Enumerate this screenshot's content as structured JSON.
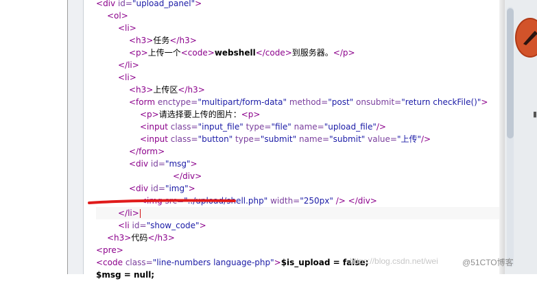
{
  "code_lines": [
    {
      "indent": 0,
      "parts": [
        {
          "t": "<",
          "k": "tag"
        },
        {
          "t": "div",
          "k": "tag"
        },
        {
          "t": " id=",
          "k": "attr"
        },
        {
          "t": "\"upload_panel\"",
          "k": "val"
        },
        {
          "t": ">",
          "k": "tag"
        }
      ]
    },
    {
      "indent": 1,
      "parts": [
        {
          "t": "<ol>",
          "k": "tag"
        }
      ]
    },
    {
      "indent": 2,
      "parts": [
        {
          "t": "<li>",
          "k": "tag"
        }
      ]
    },
    {
      "indent": 3,
      "parts": [
        {
          "t": "<h3>",
          "k": "tag"
        },
        {
          "t": "任务",
          "k": "text"
        },
        {
          "t": "</h3>",
          "k": "tag"
        }
      ]
    },
    {
      "indent": 3,
      "parts": [
        {
          "t": "<p>",
          "k": "tag"
        },
        {
          "t": "上传一个",
          "k": "text"
        },
        {
          "t": "<code>",
          "k": "tag"
        },
        {
          "t": "webshell",
          "k": "bold"
        },
        {
          "t": "</code>",
          "k": "tag"
        },
        {
          "t": "到服务器。",
          "k": "text"
        },
        {
          "t": "</p>",
          "k": "tag"
        }
      ]
    },
    {
      "indent": 2,
      "parts": [
        {
          "t": "</li>",
          "k": "tag"
        }
      ]
    },
    {
      "indent": 2,
      "parts": [
        {
          "t": "<li>",
          "k": "tag"
        }
      ]
    },
    {
      "indent": 3,
      "parts": [
        {
          "t": "<h3>",
          "k": "tag"
        },
        {
          "t": "上传区",
          "k": "text"
        },
        {
          "t": "</h3>",
          "k": "tag"
        }
      ]
    },
    {
      "indent": 3,
      "parts": [
        {
          "t": "<form",
          "k": "tag"
        },
        {
          "t": " enctype=",
          "k": "attr"
        },
        {
          "t": "\"multipart/form-data\"",
          "k": "val"
        },
        {
          "t": " method=",
          "k": "attr"
        },
        {
          "t": "\"post\"",
          "k": "val"
        },
        {
          "t": " onsubmit=",
          "k": "attr"
        },
        {
          "t": "\"return checkFile()\"",
          "k": "val"
        },
        {
          "t": ">",
          "k": "tag"
        }
      ]
    },
    {
      "indent": 4,
      "parts": [
        {
          "t": "<p>",
          "k": "tag"
        },
        {
          "t": "请选择要上传的图片：",
          "k": "text"
        },
        {
          "t": "<p>",
          "k": "tag"
        }
      ]
    },
    {
      "indent": 4,
      "parts": [
        {
          "t": "<input",
          "k": "tag"
        },
        {
          "t": " class=",
          "k": "attr"
        },
        {
          "t": "\"input_file\"",
          "k": "val"
        },
        {
          "t": " type=",
          "k": "attr"
        },
        {
          "t": "\"file\"",
          "k": "val"
        },
        {
          "t": " name=",
          "k": "attr"
        },
        {
          "t": "\"upload_file\"",
          "k": "val"
        },
        {
          "t": "/>",
          "k": "tag"
        }
      ]
    },
    {
      "indent": 4,
      "parts": [
        {
          "t": "<input",
          "k": "tag"
        },
        {
          "t": " class=",
          "k": "attr"
        },
        {
          "t": "\"button\"",
          "k": "val"
        },
        {
          "t": " type=",
          "k": "attr"
        },
        {
          "t": "\"submit\"",
          "k": "val"
        },
        {
          "t": " name=",
          "k": "attr"
        },
        {
          "t": "\"submit\"",
          "k": "val"
        },
        {
          "t": " value=",
          "k": "attr"
        },
        {
          "t": "\"上传\"",
          "k": "val"
        },
        {
          "t": "/>",
          "k": "tag"
        }
      ]
    },
    {
      "indent": 3,
      "parts": [
        {
          "t": "</form>",
          "k": "tag"
        }
      ]
    },
    {
      "indent": 3,
      "parts": [
        {
          "t": "<div",
          "k": "tag"
        },
        {
          "t": " id=",
          "k": "attr"
        },
        {
          "t": "\"msg\"",
          "k": "val"
        },
        {
          "t": ">",
          "k": "tag"
        }
      ]
    },
    {
      "indent": 7,
      "parts": [
        {
          "t": "</div>",
          "k": "tag"
        }
      ]
    },
    {
      "indent": 3,
      "parts": [
        {
          "t": "<div",
          "k": "tag"
        },
        {
          "t": " id=",
          "k": "attr"
        },
        {
          "t": "\"img\"",
          "k": "val"
        },
        {
          "t": ">",
          "k": "tag"
        }
      ]
    },
    {
      "indent": 4,
      "parts": [
        {
          "t": "<img",
          "k": "tag"
        },
        {
          "t": " src=",
          "k": "attr"
        },
        {
          "t": "\"../upload/shell.php\"",
          "k": "val"
        },
        {
          "t": " width=",
          "k": "attr"
        },
        {
          "t": "\"250px\"",
          "k": "val"
        },
        {
          "t": " />",
          "k": "tag"
        },
        {
          "t": "            ",
          "k": "text"
        },
        {
          "t": "</div>",
          "k": "tag"
        }
      ]
    },
    {
      "indent": 2,
      "parts": [
        {
          "t": "</li>",
          "k": "tag"
        }
      ],
      "cursor": true,
      "highlight": true
    },
    {
      "indent": 2,
      "parts": [
        {
          "t": "<li",
          "k": "tag"
        },
        {
          "t": " id=",
          "k": "attr"
        },
        {
          "t": "\"show_code\"",
          "k": "val"
        },
        {
          "t": ">",
          "k": "tag"
        }
      ]
    },
    {
      "indent": 1,
      "parts": [
        {
          "t": "<h3>",
          "k": "tag"
        },
        {
          "t": "代码",
          "k": "text"
        },
        {
          "t": "</h3>",
          "k": "tag"
        }
      ]
    },
    {
      "indent": 0,
      "parts": [
        {
          "t": "<pre>",
          "k": "tag"
        }
      ]
    },
    {
      "indent": 0,
      "parts": [
        {
          "t": "<code",
          "k": "tag"
        },
        {
          "t": " class=",
          "k": "attr"
        },
        {
          "t": "\"line-numbers language-php\"",
          "k": "val"
        },
        {
          "t": ">",
          "k": "tag"
        },
        {
          "t": "$is_upload = false;",
          "k": "bold"
        }
      ]
    },
    {
      "indent": 0,
      "parts": [
        {
          "t": "$msg = null;",
          "k": "bold"
        }
      ]
    }
  ],
  "watermark": {
    "url_text": "https://blog.csdn.net/wei",
    "site_text": "@51CTO博客"
  },
  "colors": {
    "tag": "#8b008b",
    "attr": "#7a3e9d",
    "value": "#1a1aa6",
    "annotation": "#e01b1b"
  }
}
